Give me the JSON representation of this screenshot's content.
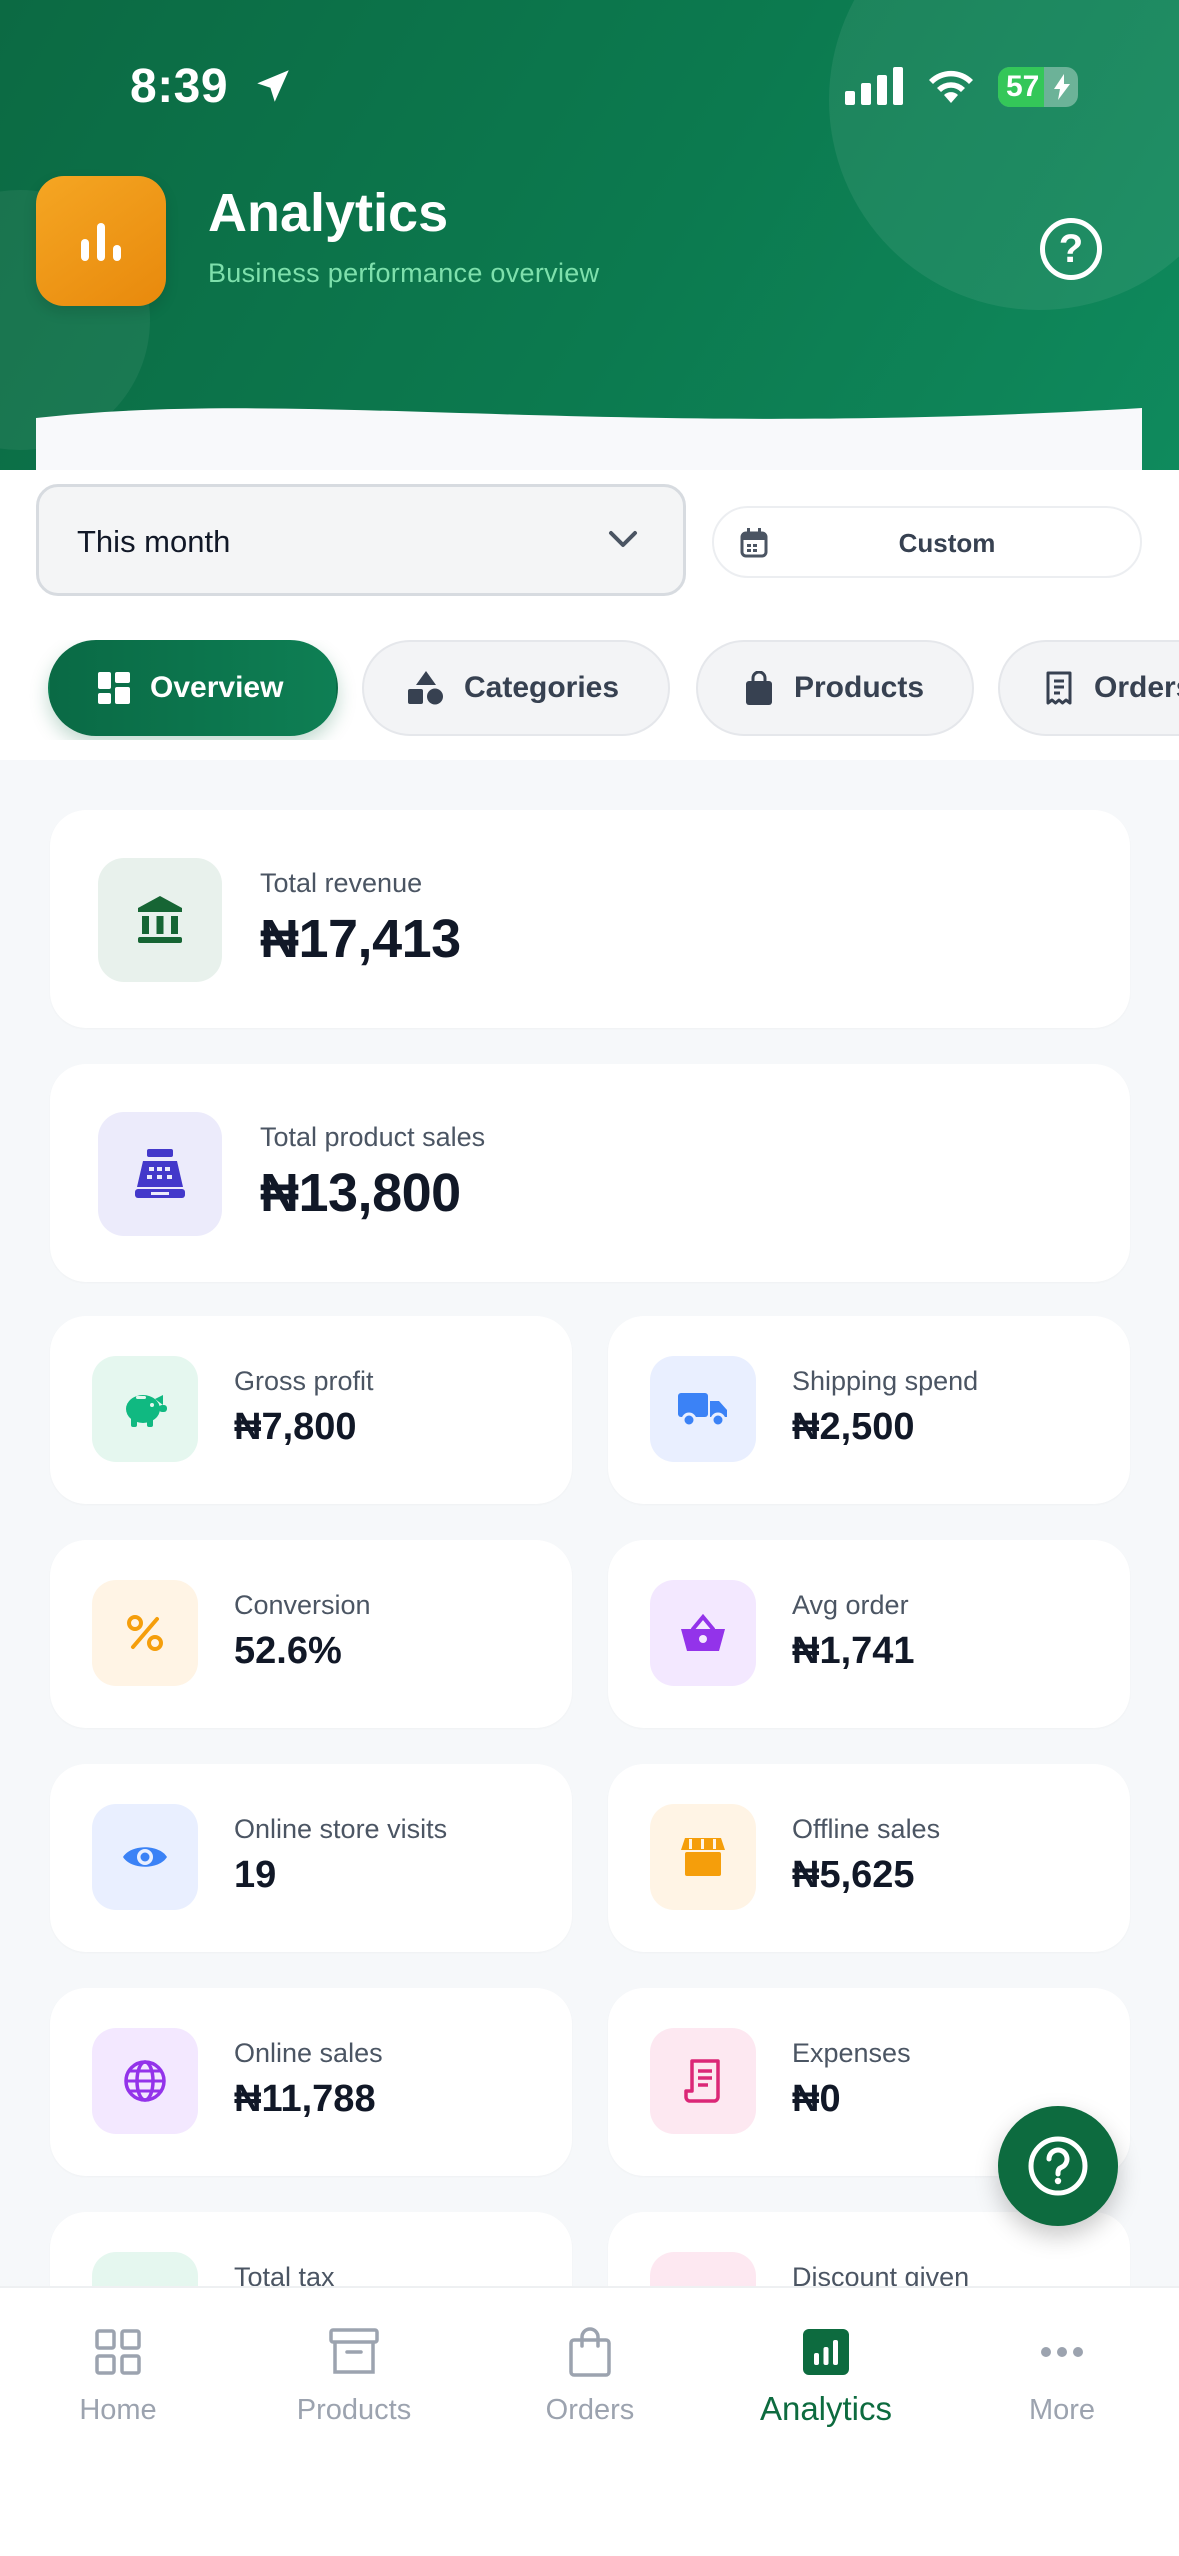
{
  "status": {
    "time": "8:39",
    "battery": "57"
  },
  "header": {
    "title": "Analytics",
    "subtitle": "Business performance overview"
  },
  "filters": {
    "period": "This month",
    "custom_label": "Custom",
    "tabs": [
      {
        "label": "Overview",
        "icon": "grid-icon",
        "active": true
      },
      {
        "label": "Categories",
        "icon": "shapes-icon",
        "active": false
      },
      {
        "label": "Products",
        "icon": "bag-icon",
        "active": false
      },
      {
        "label": "Orders",
        "icon": "receipt-icon",
        "active": false
      }
    ]
  },
  "metrics": {
    "total_revenue": {
      "label": "Total revenue",
      "value": "₦17,413",
      "icon": "bank-icon"
    },
    "total_product_sales": {
      "label": "Total product sales",
      "value": "₦13,800",
      "icon": "cash-register-icon"
    },
    "gross_profit": {
      "label": "Gross profit",
      "value": "₦7,800",
      "icon": "piggy-bank-icon"
    },
    "shipping_spend": {
      "label": "Shipping spend",
      "value": "₦2,500",
      "icon": "truck-icon"
    },
    "conversion": {
      "label": "Conversion",
      "value": "52.6%",
      "icon": "percent-icon"
    },
    "avg_order": {
      "label": "Avg order",
      "value": "₦1,741",
      "icon": "basket-icon"
    },
    "online_store_visits": {
      "label": "Online store visits",
      "value": "19",
      "icon": "eye-icon"
    },
    "offline_sales": {
      "label": "Offline sales",
      "value": "₦5,625",
      "icon": "store-icon"
    },
    "online_sales": {
      "label": "Online sales",
      "value": "₦11,788",
      "icon": "globe-icon"
    },
    "expenses": {
      "label": "Expenses",
      "value": "₦0",
      "icon": "receipt-icon"
    },
    "total_tax": {
      "label": "Total tax"
    },
    "discount_given": {
      "label": "Discount given"
    }
  },
  "nav": [
    {
      "label": "Home",
      "icon": "grid-icon"
    },
    {
      "label": "Products",
      "icon": "archive-box-icon"
    },
    {
      "label": "Orders",
      "icon": "shopping-bag-icon"
    },
    {
      "label": "Analytics",
      "icon": "bar-chart-icon",
      "active": true
    },
    {
      "label": "More",
      "icon": "more-dots-icon"
    }
  ],
  "colors": {
    "brand": "#0d6b3f",
    "accent": "#f5a623"
  }
}
